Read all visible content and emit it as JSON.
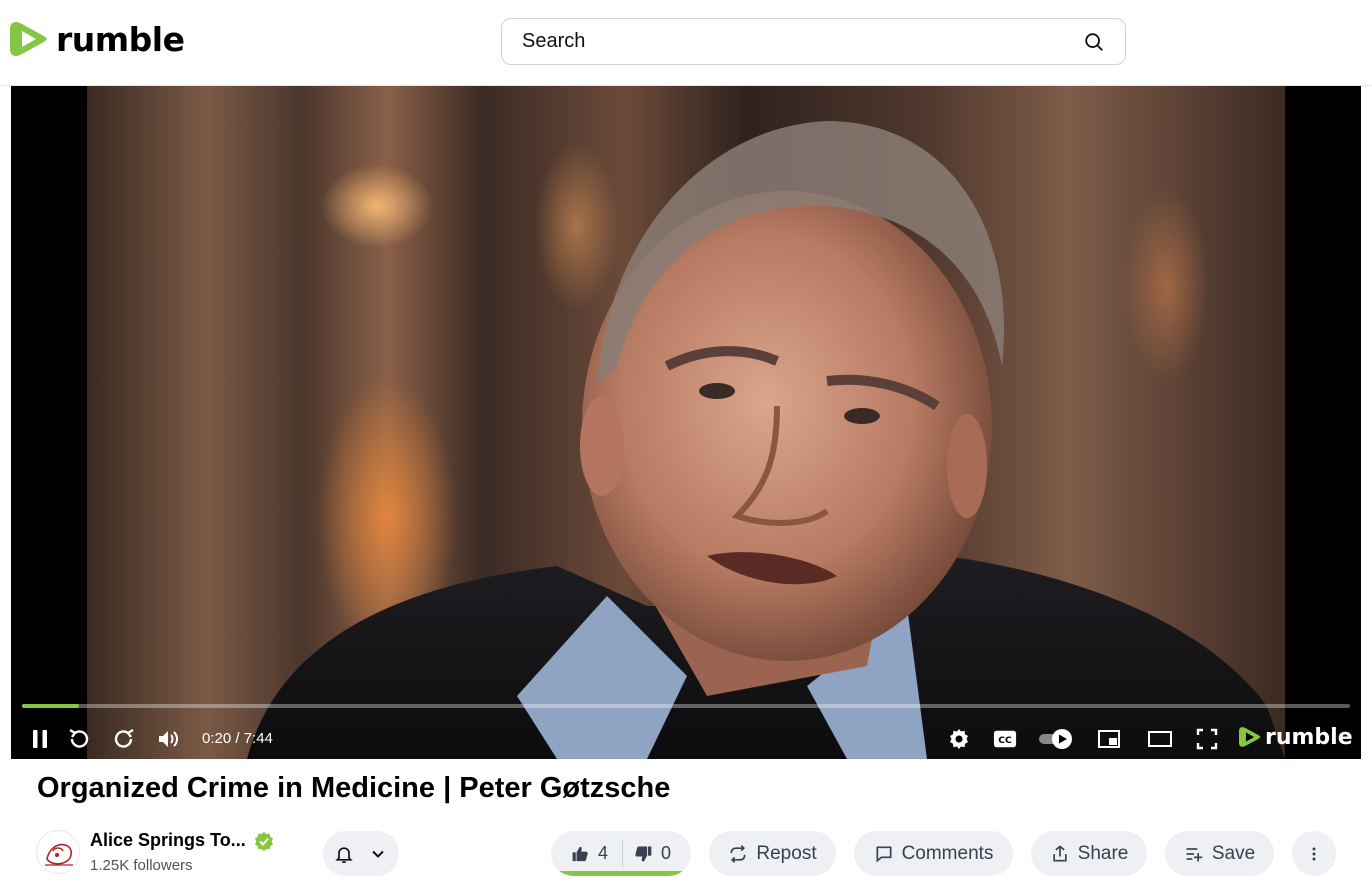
{
  "header": {
    "logo_text": "rumble",
    "brand_color": "#85c742",
    "search": {
      "placeholder": "Search",
      "icon": "search-icon"
    }
  },
  "player": {
    "time_display": "0:20 / 7:44",
    "progress_fraction": 0.043,
    "logo_text": "rumble",
    "controls": [
      "pause-icon",
      "rewind-icon",
      "forward-icon",
      "volume-icon",
      "settings-icon",
      "captions-icon",
      "autoplay-toggle",
      "pip-icon",
      "theater-icon",
      "fullscreen-icon"
    ]
  },
  "video": {
    "title": "Organized Crime in Medicine | Peter Gøtzsche"
  },
  "channel": {
    "name": "Alice Springs To...",
    "followers": "1.25K followers",
    "verified": true
  },
  "actions": {
    "likes": "4",
    "dislikes": "0",
    "repost_label": "Repost",
    "comments_label": "Comments",
    "share_label": "Share",
    "save_label": "Save"
  }
}
